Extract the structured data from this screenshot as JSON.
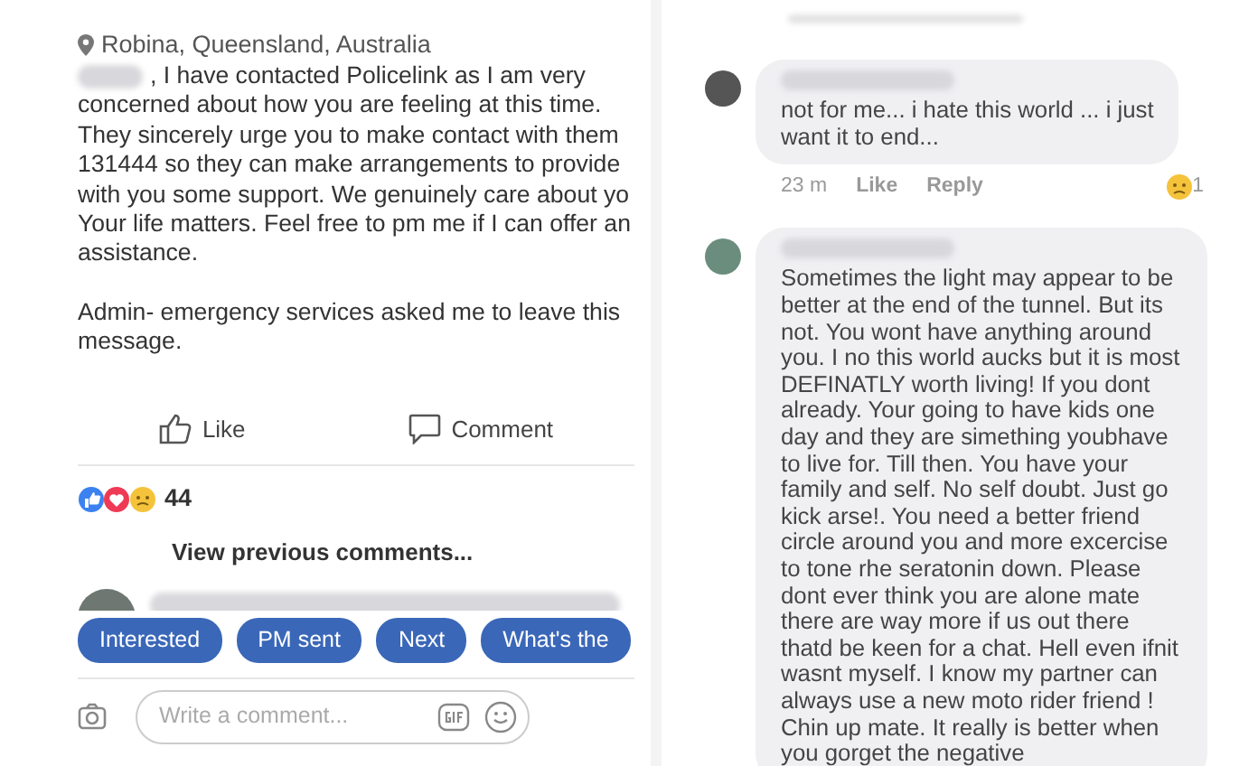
{
  "post": {
    "location": "Robina, Queensland, Australia",
    "body_lines": [
      ", I have contacted Policelink as I am very",
      "concerned about how you are feeling at this time.",
      "They sincerely urge you to make contact with them",
      "131444 so they can make arrangements to provide",
      "with you some support. We genuinely care about yo",
      "Your life matters. Feel free to pm me if I can offer an",
      "assistance."
    ],
    "note_lines": [
      "Admin- emergency services asked me to leave this",
      "message."
    ]
  },
  "actions": [
    {
      "kind": "like",
      "label": "Like"
    },
    {
      "kind": "comment",
      "label": "Comment"
    }
  ],
  "reactions": {
    "count": "44"
  },
  "view_previous": "View previous comments...",
  "quick_replies": [
    "Interested",
    "PM sent",
    "Next",
    "What's the"
  ],
  "composer": {
    "placeholder": "Write a comment..."
  },
  "comments": [
    {
      "lines": [
        "not for me... i hate this world ... i just",
        "want it to end..."
      ],
      "time": "23 m",
      "like": "Like",
      "reply": "Reply",
      "reaction_count": "1"
    },
    {
      "lines": [
        "Sometimes the light may appear to be",
        "better at the end of the tunnel. But its",
        "not.  You wont have anything around",
        "you. I no this world aucks but it is most",
        "DEFINATLY worth living! If you dont",
        "already. Your going to have kids one",
        "day and they are simething youbhave",
        "to live for.  Till then. You have your",
        "family and self. No self doubt. Just go",
        "kick arse!. You need a better friend",
        "circle around you and more excercise",
        "to tone rhe seratonin down. Please",
        "dont ever think you are alone mate",
        "there are way more if us out there",
        "thatd be keen for a chat. Hell even ifnit",
        "wasnt myself. I know my partner can",
        "always use a new moto rider friend !",
        "Chin up mate. It really is better when",
        "you gorget the negative"
      ]
    }
  ]
}
